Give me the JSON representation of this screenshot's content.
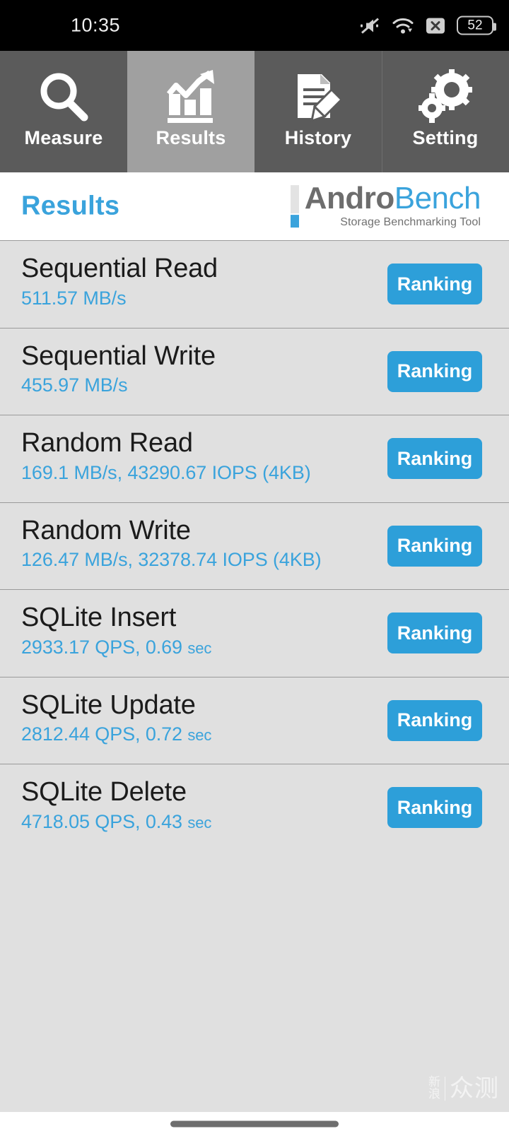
{
  "statusbar": {
    "time": "10:35",
    "battery_level": "52",
    "icons": [
      "mute-icon",
      "wifi-icon",
      "x-badge-icon",
      "battery-icon"
    ]
  },
  "tabs": [
    {
      "label": "Measure",
      "icon": "magnifier-icon",
      "active": false
    },
    {
      "label": "Results",
      "icon": "bar-chart-arrow-icon",
      "active": true
    },
    {
      "label": "History",
      "icon": "document-pencil-icon",
      "active": false
    },
    {
      "label": "Setting",
      "icon": "gears-icon",
      "active": false
    }
  ],
  "header": {
    "title": "Results",
    "logo_andro": "Andro",
    "logo_bench": "Bench",
    "logo_subtitle": "Storage Benchmarking Tool"
  },
  "results": [
    {
      "title": "Sequential Read",
      "value": "511.57 MB/s",
      "unit_small": "",
      "button": "Ranking"
    },
    {
      "title": "Sequential Write",
      "value": "455.97 MB/s",
      "unit_small": "",
      "button": "Ranking"
    },
    {
      "title": "Random Read",
      "value": "169.1 MB/s, 43290.67 IOPS (4KB)",
      "unit_small": "",
      "button": "Ranking"
    },
    {
      "title": "Random Write",
      "value": "126.47 MB/s, 32378.74 IOPS (4KB)",
      "unit_small": "",
      "button": "Ranking"
    },
    {
      "title": "SQLite Insert",
      "value": "2933.17 QPS, 0.69 ",
      "unit_small": "sec",
      "button": "Ranking"
    },
    {
      "title": "SQLite Update",
      "value": "2812.44 QPS, 0.72 ",
      "unit_small": "sec",
      "button": "Ranking"
    },
    {
      "title": "SQLite Delete",
      "value": "4718.05 QPS, 0.43 ",
      "unit_small": "sec",
      "button": "Ranking"
    }
  ],
  "watermark": {
    "line1": "新",
    "line2": "浪",
    "big": "众测"
  },
  "colors": {
    "accent_blue": "#3aa3dc",
    "button_blue": "#2d9fd9",
    "list_bg": "#e0e0e0",
    "tab_inactive": "#5b5b5b",
    "tab_active": "#a0a0a0",
    "statusbar_bg": "#000000"
  }
}
